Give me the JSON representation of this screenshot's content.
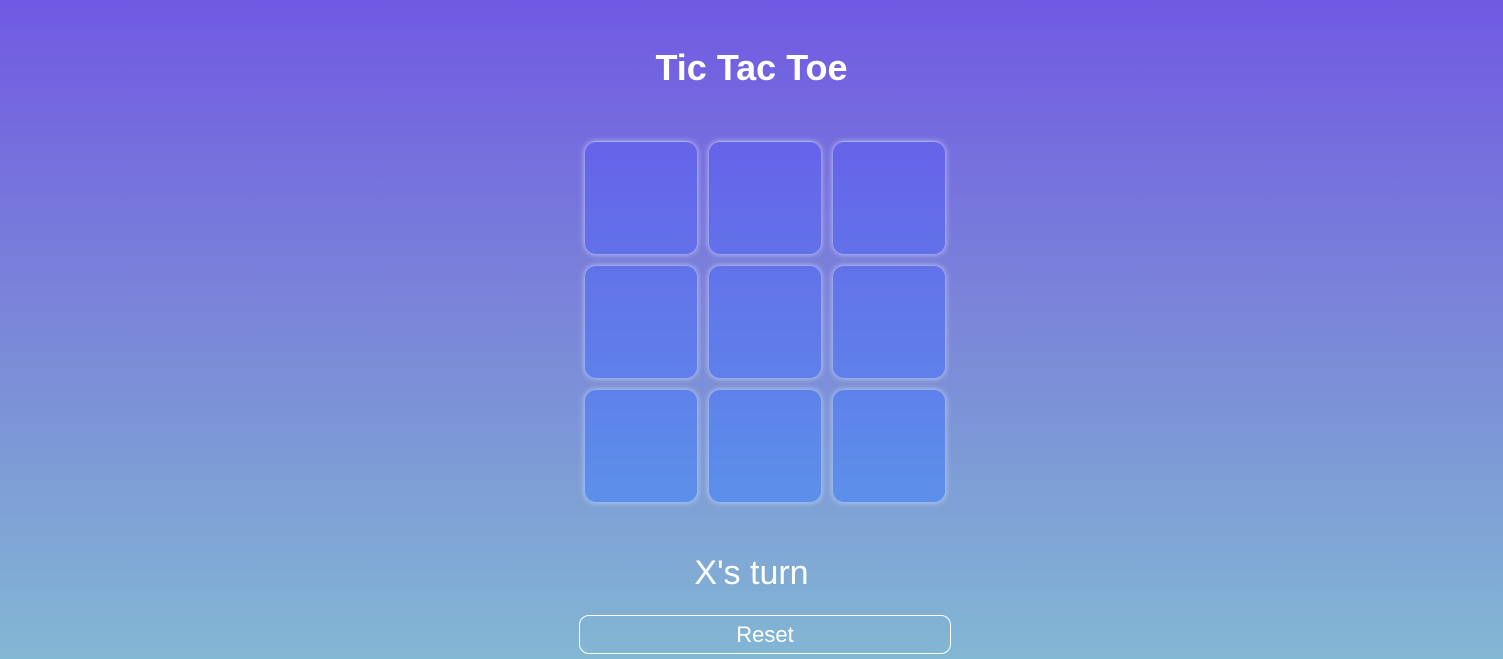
{
  "title": "Tic Tac Toe",
  "board": {
    "cells": [
      "",
      "",
      "",
      "",
      "",
      "",
      "",
      "",
      ""
    ]
  },
  "status": "X's turn",
  "reset_label": "Reset",
  "colors": {
    "background_top": "#7059e2",
    "background_bottom": "#82b7d3",
    "cell_top": "#6663e9",
    "cell_bottom": "#5b90ea",
    "text": "#ffffff"
  }
}
